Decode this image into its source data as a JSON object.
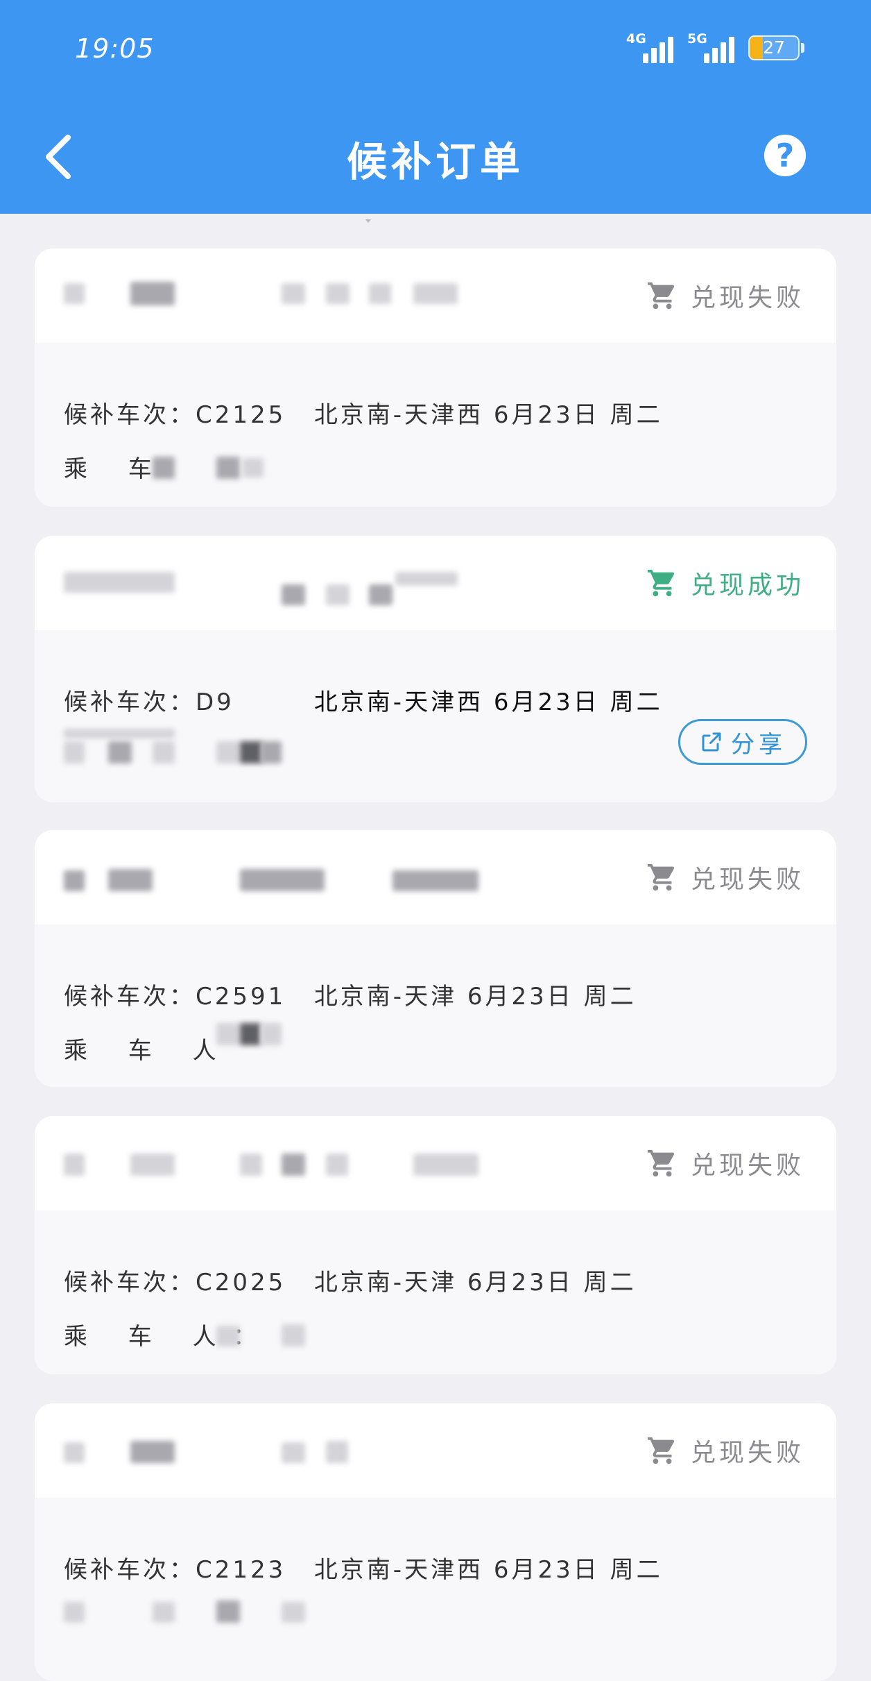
{
  "status_bar": {
    "time": "19:05",
    "network1": "4G",
    "network2": "5G",
    "battery": "27",
    "battery_level": 0.27
  },
  "header": {
    "title": "候补订单"
  },
  "labels": {
    "train_prefix": "候补车次：",
    "passenger_prefix": "乘 车 人："
  },
  "orders": [
    {
      "status": "兑现失败",
      "status_type": "fail",
      "train": "C2125",
      "route": "北京南-天津西",
      "date": "6月23日 周二",
      "passenger_label": "乘 车"
    },
    {
      "status": "兑现成功",
      "status_type": "success",
      "train": "D9",
      "route": "北京南-天津西",
      "date": "6月23日 周二",
      "passenger_label": "",
      "share_label": "分享"
    },
    {
      "status": "兑现失败",
      "status_type": "fail",
      "train": "C2591",
      "route": "北京南-天津",
      "date": "6月23日 周二",
      "passenger_label": "乘 车 人"
    },
    {
      "status": "兑现失败",
      "status_type": "fail",
      "train": "C2025",
      "route": "北京南-天津",
      "date": "6月23日 周二",
      "passenger_label": "乘 车 人："
    },
    {
      "status": "兑现失败",
      "status_type": "fail",
      "train": "C2123",
      "route": "北京南-天津西",
      "date": "6月23日 周二",
      "passenger_label": ""
    }
  ],
  "colors": {
    "header": "#3d96f2",
    "fail": "#8a8a8f",
    "success": "#3fae84",
    "share": "#2f93d6"
  }
}
